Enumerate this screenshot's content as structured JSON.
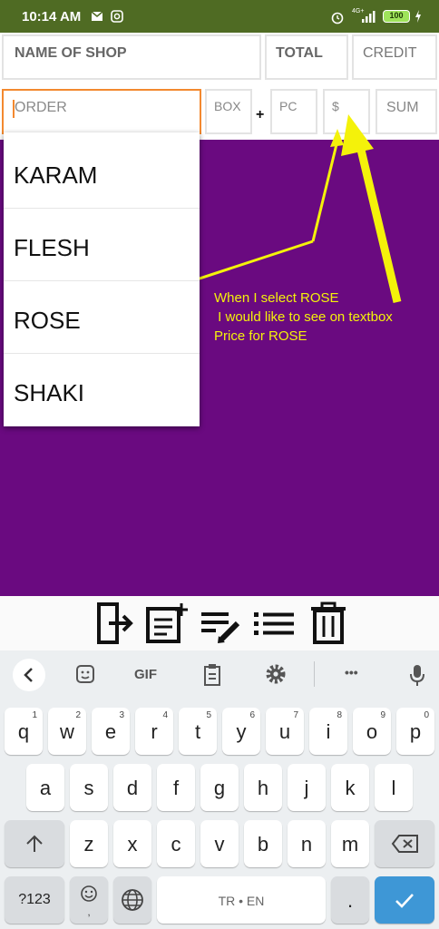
{
  "status_bar": {
    "time": "10:14 AM",
    "network": "4G+",
    "battery": "100"
  },
  "form": {
    "shop_placeholder": "NAME OF SHOP",
    "total_placeholder": "TOTAL",
    "credit_placeholder": "CREDIT",
    "order_placeholder": "ORDER",
    "box_placeholder": "BOX",
    "plus": "+",
    "pc_placeholder": "PC",
    "price_placeholder": "$",
    "sum_placeholder": "SUM"
  },
  "dropdown": {
    "items": [
      "KARAM",
      "FLESH",
      "ROSE",
      "SHAKI"
    ]
  },
  "annotation": {
    "lines": [
      "When I select ROSE",
      " I would like to see on textbox",
      "Price for ROSE"
    ]
  },
  "keyboard": {
    "row1": [
      {
        "ch": "q",
        "num": "1"
      },
      {
        "ch": "w",
        "num": "2"
      },
      {
        "ch": "e",
        "num": "3"
      },
      {
        "ch": "r",
        "num": "4"
      },
      {
        "ch": "t",
        "num": "5"
      },
      {
        "ch": "y",
        "num": "6"
      },
      {
        "ch": "u",
        "num": "7"
      },
      {
        "ch": "i",
        "num": "8"
      },
      {
        "ch": "o",
        "num": "9"
      },
      {
        "ch": "p",
        "num": "0"
      }
    ],
    "row2": [
      "a",
      "s",
      "d",
      "f",
      "g",
      "h",
      "j",
      "k",
      "l"
    ],
    "row3": [
      "z",
      "x",
      "c",
      "v",
      "b",
      "n",
      "m"
    ],
    "symbols_label": "?123",
    "space_label": "TR • EN",
    "period": ".",
    "gif_label": "GIF",
    "more_label": "•••"
  },
  "colors": {
    "status_bar": "#4f6b23",
    "purple": "#6a0a80",
    "annotation": "#f4f20a",
    "order_border": "#f3892f",
    "enter_key": "#3e97d6"
  }
}
